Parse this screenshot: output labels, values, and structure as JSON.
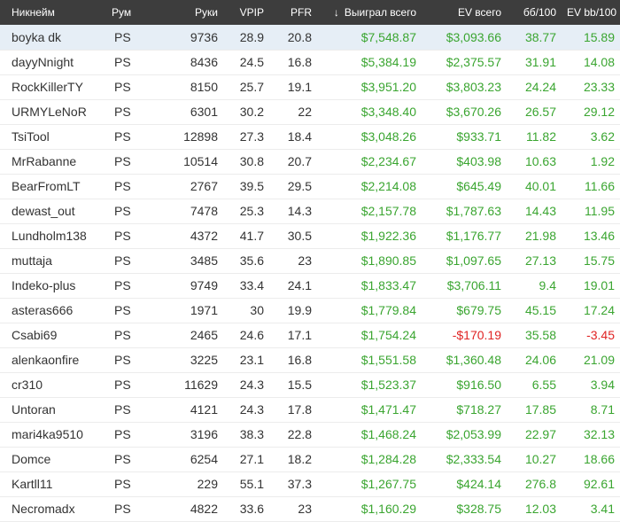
{
  "headers": {
    "nick": "Никнейм",
    "room": "Рум",
    "hands": "Руки",
    "vpip": "VPIP",
    "pfr": "PFR",
    "won_arrow": "↓",
    "won": "Выиграл всего",
    "ev": "EV всего",
    "bb100": "бб/100",
    "evbb100": "EV bb/100"
  },
  "colors": {
    "positive": "#3aa530",
    "negative": "#e02424",
    "header_bg": "#3d3d3d",
    "selected_row": "#e6eef6"
  },
  "rows": [
    {
      "nick": "boyka dk",
      "room": "PS",
      "hands": "9736",
      "vpip": "28.9",
      "pfr": "20.8",
      "won": "$7,548.87",
      "ev": "$3,093.66",
      "bb100": "38.77",
      "evbb100": "15.89"
    },
    {
      "nick": "dayyNnight",
      "room": "PS",
      "hands": "8436",
      "vpip": "24.5",
      "pfr": "16.8",
      "won": "$5,384.19",
      "ev": "$2,375.57",
      "bb100": "31.91",
      "evbb100": "14.08"
    },
    {
      "nick": "RockKillerTY",
      "room": "PS",
      "hands": "8150",
      "vpip": "25.7",
      "pfr": "19.1",
      "won": "$3,951.20",
      "ev": "$3,803.23",
      "bb100": "24.24",
      "evbb100": "23.33"
    },
    {
      "nick": "URMYLeNoR",
      "room": "PS",
      "hands": "6301",
      "vpip": "30.2",
      "pfr": "22",
      "won": "$3,348.40",
      "ev": "$3,670.26",
      "bb100": "26.57",
      "evbb100": "29.12"
    },
    {
      "nick": "TsiTool",
      "room": "PS",
      "hands": "12898",
      "vpip": "27.3",
      "pfr": "18.4",
      "won": "$3,048.26",
      "ev": "$933.71",
      "bb100": "11.82",
      "evbb100": "3.62"
    },
    {
      "nick": "MrRabanne",
      "room": "PS",
      "hands": "10514",
      "vpip": "30.8",
      "pfr": "20.7",
      "won": "$2,234.67",
      "ev": "$403.98",
      "bb100": "10.63",
      "evbb100": "1.92"
    },
    {
      "nick": "BearFromLT",
      "room": "PS",
      "hands": "2767",
      "vpip": "39.5",
      "pfr": "29.5",
      "won": "$2,214.08",
      "ev": "$645.49",
      "bb100": "40.01",
      "evbb100": "11.66"
    },
    {
      "nick": "dewast_out",
      "room": "PS",
      "hands": "7478",
      "vpip": "25.3",
      "pfr": "14.3",
      "won": "$2,157.78",
      "ev": "$1,787.63",
      "bb100": "14.43",
      "evbb100": "11.95"
    },
    {
      "nick": "Lundholm138",
      "room": "PS",
      "hands": "4372",
      "vpip": "41.7",
      "pfr": "30.5",
      "won": "$1,922.36",
      "ev": "$1,176.77",
      "bb100": "21.98",
      "evbb100": "13.46"
    },
    {
      "nick": "muttaja",
      "room": "PS",
      "hands": "3485",
      "vpip": "35.6",
      "pfr": "23",
      "won": "$1,890.85",
      "ev": "$1,097.65",
      "bb100": "27.13",
      "evbb100": "15.75"
    },
    {
      "nick": "Indeko-plus",
      "room": "PS",
      "hands": "9749",
      "vpip": "33.4",
      "pfr": "24.1",
      "won": "$1,833.47",
      "ev": "$3,706.11",
      "bb100": "9.4",
      "evbb100": "19.01"
    },
    {
      "nick": "asteras666",
      "room": "PS",
      "hands": "1971",
      "vpip": "30",
      "pfr": "19.9",
      "won": "$1,779.84",
      "ev": "$679.75",
      "bb100": "45.15",
      "evbb100": "17.24"
    },
    {
      "nick": "Csabi69",
      "room": "PS",
      "hands": "2465",
      "vpip": "24.6",
      "pfr": "17.1",
      "won": "$1,754.24",
      "ev": "-$170.19",
      "bb100": "35.58",
      "evbb100": "-3.45"
    },
    {
      "nick": "alenkaonfire",
      "room": "PS",
      "hands": "3225",
      "vpip": "23.1",
      "pfr": "16.8",
      "won": "$1,551.58",
      "ev": "$1,360.48",
      "bb100": "24.06",
      "evbb100": "21.09"
    },
    {
      "nick": "cr310",
      "room": "PS",
      "hands": "11629",
      "vpip": "24.3",
      "pfr": "15.5",
      "won": "$1,523.37",
      "ev": "$916.50",
      "bb100": "6.55",
      "evbb100": "3.94"
    },
    {
      "nick": "Untoran",
      "room": "PS",
      "hands": "4121",
      "vpip": "24.3",
      "pfr": "17.8",
      "won": "$1,471.47",
      "ev": "$718.27",
      "bb100": "17.85",
      "evbb100": "8.71"
    },
    {
      "nick": "mari4ka9510",
      "room": "PS",
      "hands": "3196",
      "vpip": "38.3",
      "pfr": "22.8",
      "won": "$1,468.24",
      "ev": "$2,053.99",
      "bb100": "22.97",
      "evbb100": "32.13"
    },
    {
      "nick": "Domce",
      "room": "PS",
      "hands": "6254",
      "vpip": "27.1",
      "pfr": "18.2",
      "won": "$1,284.28",
      "ev": "$2,333.54",
      "bb100": "10.27",
      "evbb100": "18.66"
    },
    {
      "nick": "Kartll11",
      "room": "PS",
      "hands": "229",
      "vpip": "55.1",
      "pfr": "37.3",
      "won": "$1,267.75",
      "ev": "$424.14",
      "bb100": "276.8",
      "evbb100": "92.61"
    },
    {
      "nick": "Necromadx",
      "room": "PS",
      "hands": "4822",
      "vpip": "33.6",
      "pfr": "23",
      "won": "$1,160.29",
      "ev": "$328.75",
      "bb100": "12.03",
      "evbb100": "3.41"
    }
  ]
}
